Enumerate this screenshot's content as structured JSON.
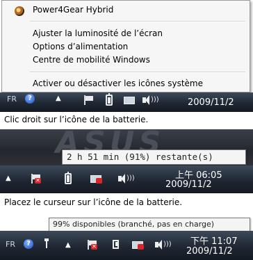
{
  "context_menu": {
    "items": [
      "Power4Gear Hybrid",
      "Ajuster la luminosité de l’écran",
      "Options d’alimentation",
      "Centre de mobilité Windows",
      "Activer ou désactiver les icônes système"
    ]
  },
  "taskbar1": {
    "lang": "FR",
    "date": "2009/11/2"
  },
  "captions": {
    "first": "Clic droit sur l’icône de la batterie.",
    "second": "Placez le curseur sur l’icône de la batterie."
  },
  "desktop": {
    "logo_text": "ASUS"
  },
  "tooltips": {
    "battery_remaining": "2 h 51 min (91%) restante(s)",
    "plugged_in": "99% disponibles (branché, pas en charge)"
  },
  "taskbar2": {
    "time": "上午 06:05",
    "date": "2009/11/2"
  },
  "taskbar3": {
    "lang": "FR",
    "time": "下午 11:07",
    "date": "2009/11/2"
  },
  "icons": {
    "app": "power4gear-icon",
    "help": "help-icon",
    "flag": "action-center-flag-icon",
    "battery": "battery-icon",
    "plug": "battery-plugged-icon",
    "network": "network-icon",
    "volume": "volume-icon",
    "arrow": "show-hidden-icons-arrow-icon"
  },
  "battery_fill": {
    "panel1": 0.91,
    "panel2": 0.91,
    "panel3": 0.99
  }
}
